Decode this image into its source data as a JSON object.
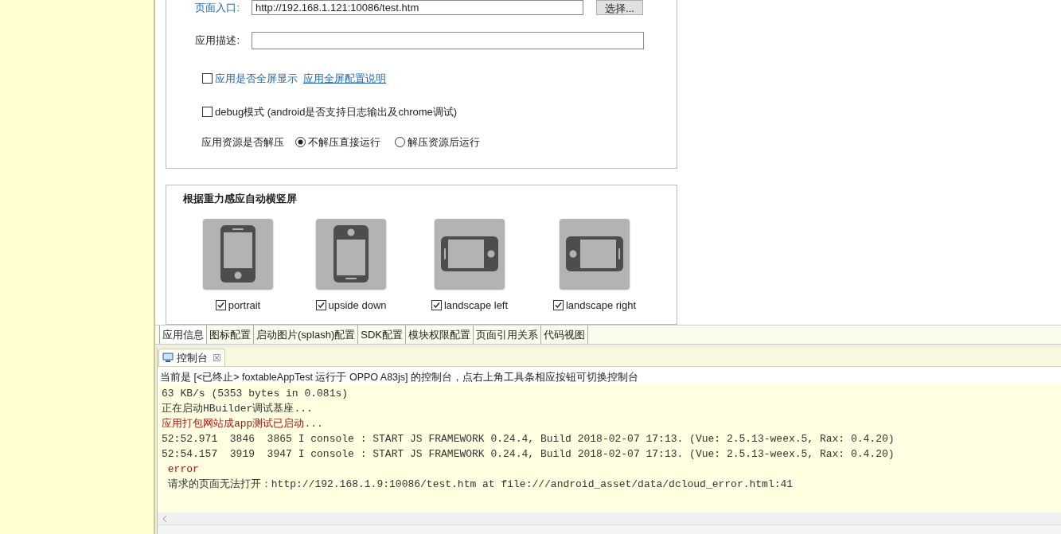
{
  "form": {
    "fields": [
      {
        "label": "页面入口:",
        "value": "http://192.168.1.121:10086/test.htm",
        "button": "选择..."
      },
      {
        "label": "应用描述:"
      }
    ],
    "checkboxes": [
      {
        "kind": "link",
        "label": "应用是否全屏显示",
        "link": "应用全屏配置说明",
        "checked": false
      },
      {
        "kind": "plain",
        "label": "debug模式 (android是否支持日志输出及chrome调试)",
        "checked": false
      }
    ],
    "radio_group": {
      "label": "应用资源是否解压",
      "options": [
        {
          "label": "不解压直接运行",
          "selected": true
        },
        {
          "label": "解压资源后运行",
          "selected": false
        }
      ]
    }
  },
  "orientation": {
    "title": "根据重力感应自动横竖屏",
    "items": [
      {
        "kind": "portrait",
        "label": "portrait",
        "checked": true
      },
      {
        "kind": "upside_down",
        "label": "upside down",
        "checked": true
      },
      {
        "kind": "landscape_left",
        "label": "landscape left",
        "checked": true
      },
      {
        "kind": "landscape_right",
        "label": "landscape right",
        "checked": true
      }
    ]
  },
  "editor_tabs": [
    {
      "label": "应用信息",
      "selected": true
    },
    {
      "label": "图标配置",
      "selected": false
    },
    {
      "label": "启动图片(splash)配置",
      "selected": false
    },
    {
      "label": "SDK配置",
      "selected": false
    },
    {
      "label": "模块权限配置",
      "selected": false
    },
    {
      "label": "页面引用关系",
      "selected": false
    },
    {
      "label": "代码视图",
      "selected": false
    }
  ],
  "console": {
    "tab": {
      "title": "控制台",
      "close": "☒"
    },
    "info": "当前是 [<已终止> foxtableAppTest 运行于 OPPO A83js] 的控制台，点右上角工具条相应按钮可切换控制台",
    "lines": [
      {
        "kind": "output",
        "text": "63 KB/s (5353 bytes in 0.081s)"
      },
      {
        "kind": "output",
        "text": "正在启动HBuilder调试基座..."
      },
      {
        "kind": "error",
        "text": "应用打包网站成app测试已启动..."
      },
      {
        "kind": "output",
        "text": "52:52.971  3846  3865 I console : START JS FRAMEWORK 0.24.4, Build 2018-02-07 17:13. (Vue: 2.5.13-weex.5, Rax: 0.4.20)"
      },
      {
        "kind": "output",
        "text": "52:54.157  3919  3947 I console : START JS FRAMEWORK 0.24.4, Build 2018-02-07 17:13. (Vue: 2.5.13-weex.5, Rax: 0.4.20)"
      },
      {
        "kind": "error",
        "text": " error"
      },
      {
        "kind": "output",
        "text": " 请求的页面无法打开：http://192.168.1.9:10086/test.htm at file:///android_asset/data/dcloud_error.html:41"
      }
    ]
  }
}
